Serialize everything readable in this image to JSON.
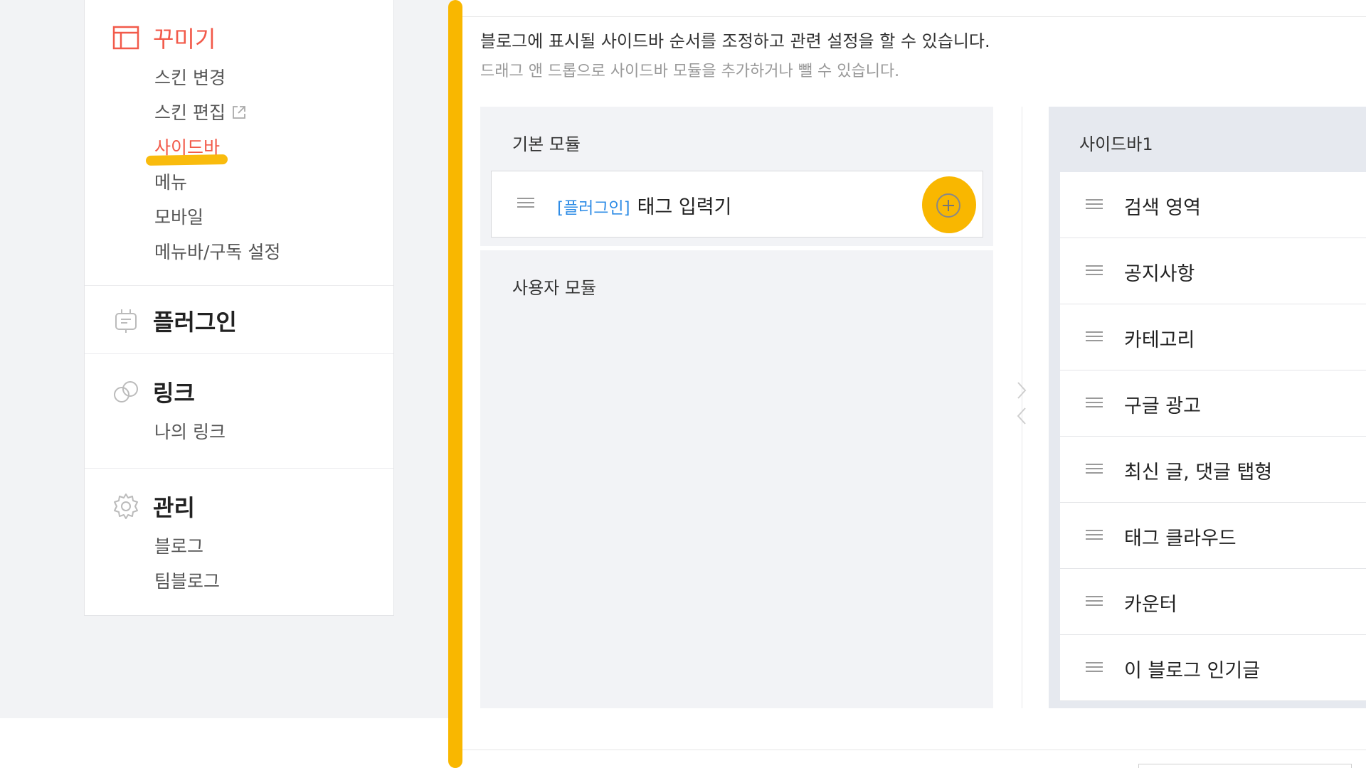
{
  "nav": {
    "decorate": {
      "title": "꾸미기",
      "items": [
        "스킨 변경",
        "스킨 편집",
        "사이드바",
        "메뉴",
        "모바일",
        "메뉴바/구독 설정"
      ]
    },
    "plugin": {
      "title": "플러그인"
    },
    "link": {
      "title": "링크",
      "items": [
        "나의 링크"
      ]
    },
    "manage": {
      "title": "관리",
      "items": [
        "블로그",
        "팀블로그"
      ]
    }
  },
  "main": {
    "description": "블로그에 표시될 사이드바 순서를 조정하고 관련 설정을 할 수 있습니다.",
    "sub_description": "드래그 앤 드롭으로 사이드바 모듈을 추가하거나 뺄 수 있습니다.",
    "basic_modules": {
      "title": "기본 모듈",
      "items": [
        {
          "prefix": "[플러그인]",
          "name": "태그 입력기"
        }
      ]
    },
    "user_modules": {
      "title": "사용자 모듈"
    },
    "sidebar1": {
      "title": "사이드바1",
      "items": [
        "검색 영역",
        "공지사항",
        "카테고리",
        "구글 광고",
        "최신 글, 댓글 탭형",
        "태그 클라우드",
        "카운터",
        "이 블로그 인기글"
      ]
    }
  },
  "colors": {
    "accent": "#f25a4a",
    "highlight": "#f9b700",
    "link_blue": "#2e8ce6"
  },
  "icons": [
    "layout-icon",
    "external-link-icon",
    "plug-icon",
    "link-icon",
    "gear-icon",
    "drag-handle-icon",
    "plus-circle-icon",
    "chevron-right-icon",
    "chevron-left-icon"
  ]
}
